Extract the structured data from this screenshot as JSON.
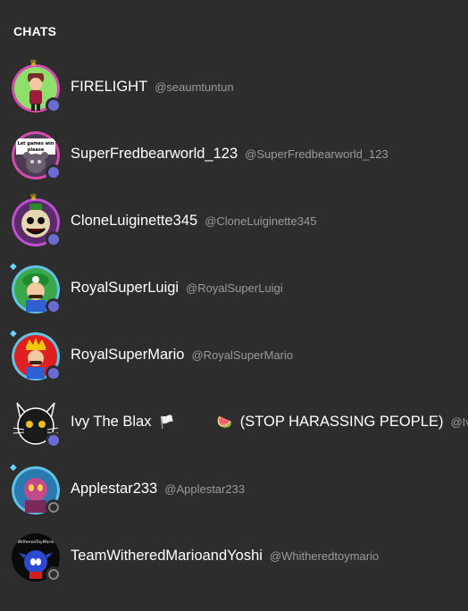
{
  "section_title": "CHATS",
  "chats": [
    {
      "display_name": "FIRELIGHT",
      "username": "@seaumtuntun",
      "status": "online",
      "badge": "crown"
    },
    {
      "display_name": "SuperFredbearworld_123",
      "username": "@SuperFredbearworld_123",
      "status": "online",
      "badge": "none",
      "avatar_text": "Let games win please"
    },
    {
      "display_name": "CloneLuiginette345",
      "username": "@CloneLuiginette345",
      "status": "online",
      "badge": "crown"
    },
    {
      "display_name": "RoyalSuperLuigi",
      "username": "@RoyalSuperLuigi",
      "status": "online",
      "badge": "gem"
    },
    {
      "display_name": "RoyalSuperMario",
      "username": "@RoyalSuperMario",
      "status": "online",
      "badge": "gem"
    },
    {
      "display_name_part1": "Ivy The Blax",
      "emoji1": "🏳️",
      "emoji2": "🍉",
      "display_name_part2": "(STOP HARASSING PEOPLE)",
      "username": "@IveeT",
      "status": "online",
      "badge": "none"
    },
    {
      "display_name": "Applestar233",
      "username": "@Applestar233",
      "status": "offline",
      "badge": "gem"
    },
    {
      "display_name": "TeamWitheredMarioandYoshi",
      "username": "@Whitheredtoymario",
      "status": "offline",
      "badge": "none",
      "avatar_text": "WitheredToyMario"
    }
  ],
  "colors": {
    "background": "#2d2d2d",
    "online_status": "#6b6bd6",
    "username_text": "#9a9a9a"
  }
}
